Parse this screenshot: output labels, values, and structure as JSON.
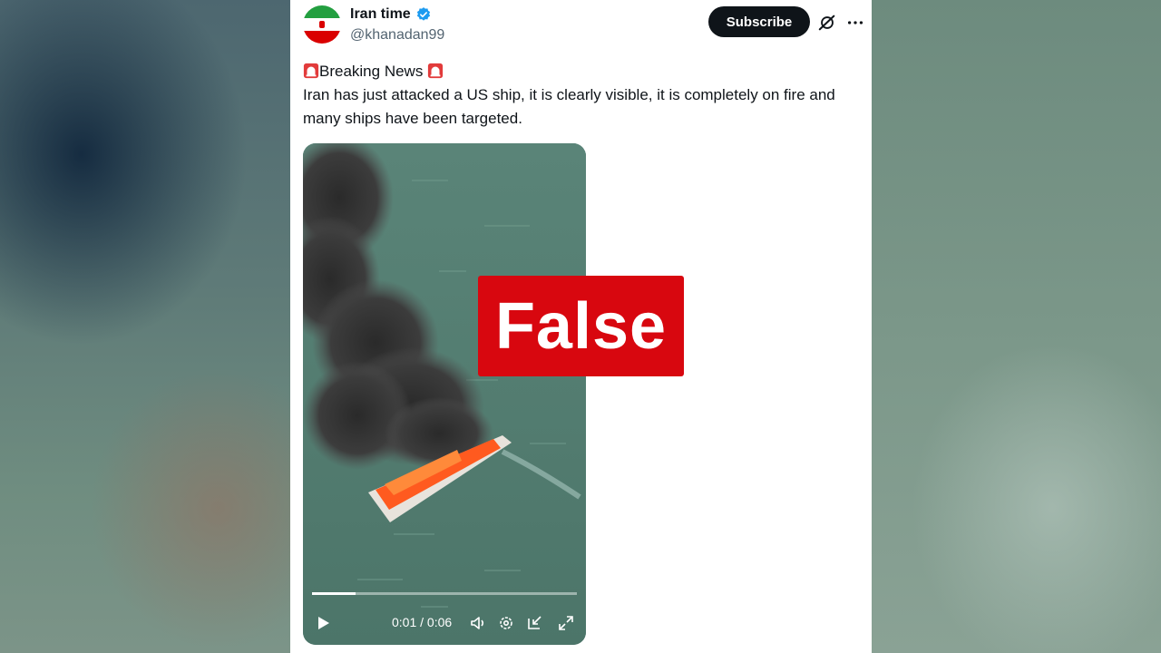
{
  "post": {
    "author_name": "Iran time",
    "handle": "@khanadan99",
    "subscribe_label": "Subscribe",
    "heading": "Breaking News",
    "body": "Iran has just attacked a US ship, it is clearly visible, it is completely on fire and many ships have been targeted."
  },
  "video": {
    "time_display": "0:01 / 0:06",
    "progress": 0.165
  },
  "fact_check": {
    "label": "False",
    "color": "#d8070f"
  },
  "icons": [
    "verified-badge-icon",
    "grok-icon",
    "more-icon",
    "siren-icon",
    "play-icon",
    "volume-icon",
    "settings-icon",
    "minimize-icon",
    "fullscreen-icon"
  ],
  "colors": {
    "subscribe_bg": "#0f1419",
    "verified_blue": "#1d9bf0",
    "flag_green": "#239f40",
    "flag_red": "#da0000"
  }
}
